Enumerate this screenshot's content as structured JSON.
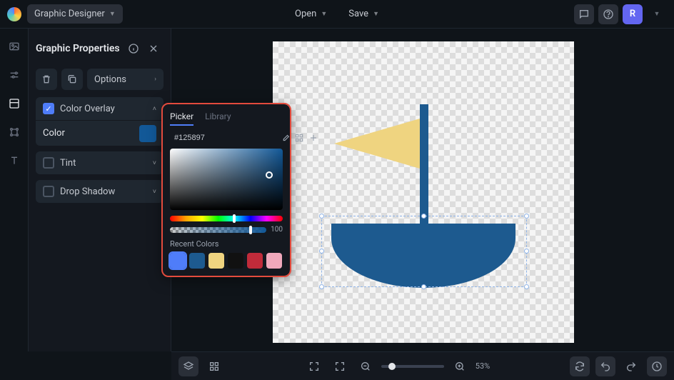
{
  "topbar": {
    "app_name": "Graphic Designer",
    "open": "Open",
    "save": "Save",
    "avatar_letter": "R"
  },
  "panel": {
    "title": "Graphic Properties",
    "options": "Options",
    "color_overlay": "Color Overlay",
    "color_label": "Color",
    "tint": "Tint",
    "drop_shadow": "Drop Shadow"
  },
  "picker": {
    "tab_picker": "Picker",
    "tab_library": "Library",
    "hex": "#125897",
    "alpha": "100",
    "recent_label": "Recent Colors",
    "recent": [
      "#4f7df9",
      "#1d5a8f",
      "#efd480",
      "#111111",
      "#c02b3a",
      "#f0a8bb"
    ]
  },
  "bottom": {
    "zoom": "53%"
  },
  "colors": {
    "overlay": "#125897"
  }
}
